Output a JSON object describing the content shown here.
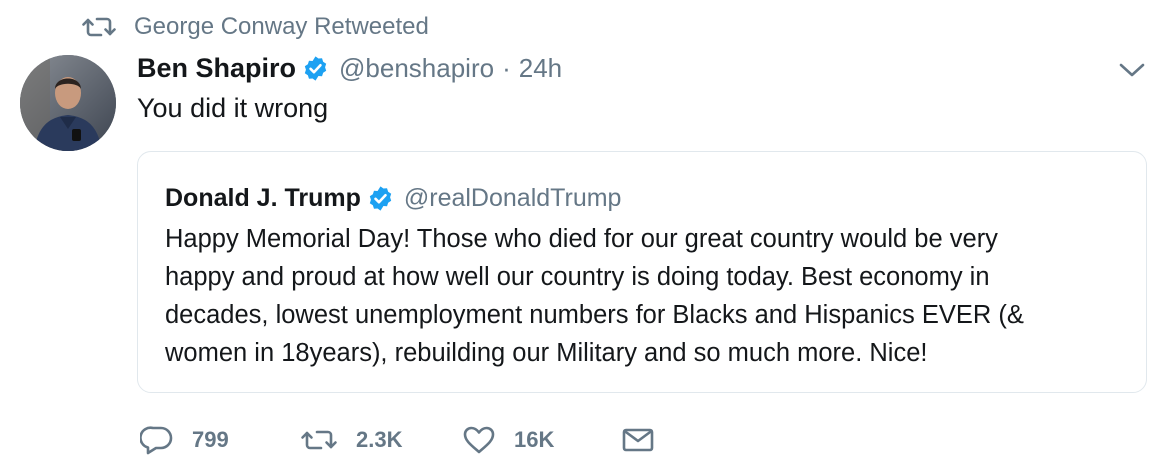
{
  "retweet_context": {
    "icon": "retweet-icon",
    "text": "George Conway Retweeted"
  },
  "tweet": {
    "avatar": "avatar-photo",
    "author_name": "Ben Shapiro",
    "verified_icon": "verified-badge-icon",
    "handle": "@benshapiro",
    "separator": "·",
    "time": "24h",
    "text": "You did it wrong",
    "caret_icon": "chevron-down-icon"
  },
  "quoted_tweet": {
    "author_name": "Donald J. Trump",
    "verified_icon": "verified-badge-icon",
    "handle": "@realDonaldTrump",
    "lines": [
      "Happy Memorial Day! Those who died for our great country would be very",
      "happy and proud at how well our country is doing today. Best economy in",
      "decades, lowest unemployment numbers for Blacks and Hispanics EVER (&",
      "women in 18years), rebuilding our Military and so much more. Nice!"
    ]
  },
  "actions": {
    "reply_count": "799",
    "retweet_count": "2.3K",
    "like_count": "16K",
    "reply_icon": "reply-icon",
    "retweet_icon": "retweet-icon",
    "like_icon": "heart-icon",
    "dm_icon": "envelope-icon"
  },
  "colors": {
    "text": "#14171a",
    "secondary": "#657786",
    "verified_blue": "#1da1f2",
    "border": "#e1e8ed"
  }
}
